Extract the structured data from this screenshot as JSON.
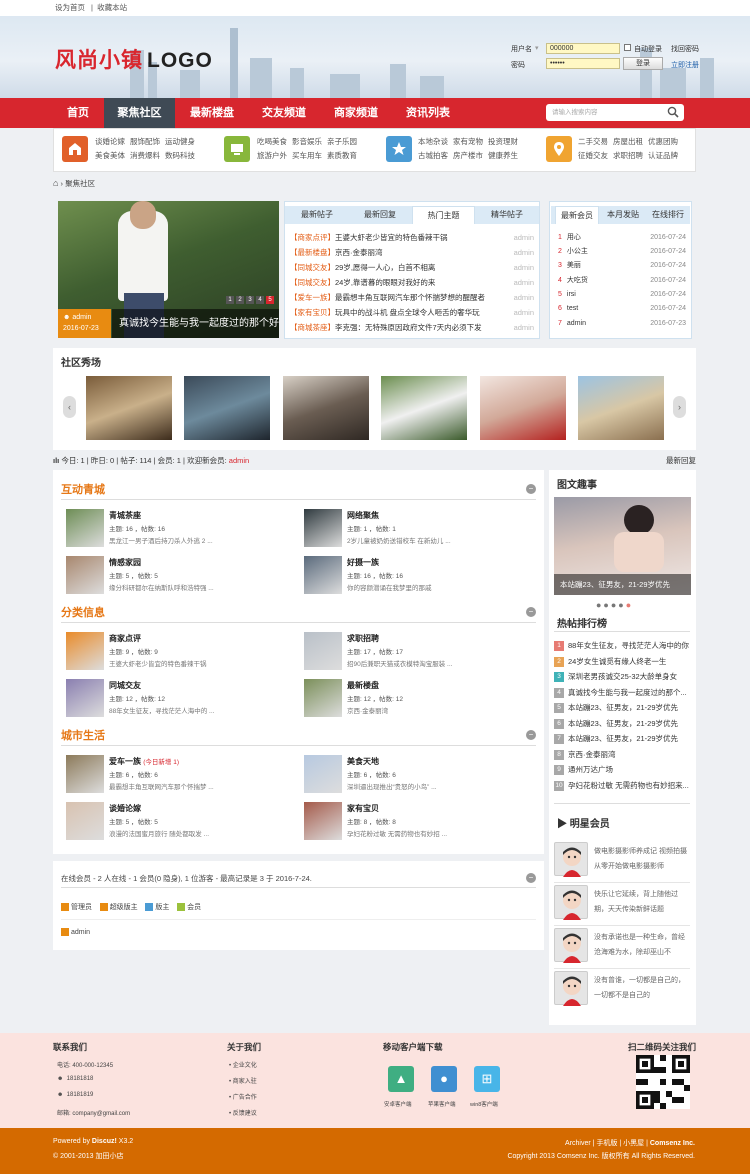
{
  "topbar": {
    "set_home": "设为首页",
    "bookmark": "收藏本站"
  },
  "header": {
    "logo_cn": "风尚小镇",
    "logo_en": "LOGO",
    "login": {
      "username_label": "用户名",
      "username_value": "000000",
      "auto_login_label": "自动登录",
      "find_password": "找回密码",
      "password_label": "密码",
      "password_value": "••••••",
      "login_button": "登录",
      "register": "立即注册"
    }
  },
  "nav": {
    "items": [
      {
        "label": "首页"
      },
      {
        "label": "聚焦社区"
      },
      {
        "label": "最新楼盘"
      },
      {
        "label": "交友频道"
      },
      {
        "label": "商家频道"
      },
      {
        "label": "资讯列表"
      }
    ],
    "active_index": 1,
    "search_placeholder": "请输入搜索内容"
  },
  "categories": [
    {
      "icon": "home-icon",
      "color": "#e1602a",
      "row1": [
        "谈婚论嫁",
        "服饰配饰",
        "运动健身"
      ],
      "row2": [
        "美食美体",
        "消费爆料",
        "数码科技"
      ]
    },
    {
      "icon": "monitor-icon",
      "color": "#88b73b",
      "row1": [
        "吃喝美食",
        "影音娱乐",
        "亲子乐园"
      ],
      "row2": [
        "旅游户外",
        "买车用车",
        "素质教育"
      ]
    },
    {
      "icon": "star-icon",
      "color": "#4a9bd4",
      "row1": [
        "本地杂谈",
        "家有宠物",
        "投资理财"
      ],
      "row2": [
        "古城拍客",
        "房产楼市",
        "健康养生"
      ]
    },
    {
      "icon": "location-icon",
      "color": "#f0a431",
      "row1": [
        "二手交易",
        "房屋出租",
        "优惠团购"
      ],
      "row2": [
        "征婚交友",
        "求职招聘",
        "认证品牌"
      ]
    }
  ],
  "breadcrumb": {
    "current": "聚焦社区"
  },
  "slider": {
    "author": "admin",
    "date": "2016-07-23",
    "title": "真诚找今生能与我一起度过的那个好",
    "pages": [
      "1",
      "2",
      "3",
      "4",
      "5"
    ],
    "active_page": 5
  },
  "posts": {
    "tabs": [
      "最新帖子",
      "最新回复",
      "热门主题",
      "精华帖子"
    ],
    "active_tab": 2,
    "rows": [
      {
        "cat": "【商家点评】",
        "title": "王婆大虾老少皆宜的特色番辣干锅",
        "author": "admin"
      },
      {
        "cat": "【最新楼盘】",
        "title": "京西·金泰丽湾",
        "author": "admin"
      },
      {
        "cat": "【同城交友】",
        "title": "29岁,愿得一人心，白首不相离",
        "author": "admin"
      },
      {
        "cat": "【同城交友】",
        "title": "24岁,靠谱暮的眼眼对我好的来",
        "author": "admin"
      },
      {
        "cat": "【爱车一族】",
        "title": "最霸想丰角互联网汽车那个怀揣梦想的醒醒者",
        "author": "admin"
      },
      {
        "cat": "【家有宝贝】",
        "title": "玩具中的战斗机 盘点全球令人咂舌的奢华玩",
        "author": "admin"
      },
      {
        "cat": "【商城茶座】",
        "title": "李克强：无特殊原因政府文件7天内必须下发",
        "author": "admin"
      }
    ]
  },
  "members": {
    "tabs": [
      "最新会员",
      "本月发贴",
      "在线排行"
    ],
    "active_tab": 0,
    "rows": [
      {
        "n": "1",
        "name": "用心",
        "date": "2016-07-24"
      },
      {
        "n": "2",
        "name": "小公主",
        "date": "2016-07-24"
      },
      {
        "n": "3",
        "name": "美丽",
        "date": "2016-07-24"
      },
      {
        "n": "4",
        "name": "大吃货",
        "date": "2016-07-24"
      },
      {
        "n": "5",
        "name": "irsi",
        "date": "2016-07-24"
      },
      {
        "n": "6",
        "name": "test",
        "date": "2016-07-24"
      },
      {
        "n": "7",
        "name": "admin",
        "date": "2016-07-23"
      }
    ]
  },
  "show": {
    "title": "社区秀场",
    "images": [
      {
        "name": "show-image-1",
        "bg": "linear-gradient(160deg,#7a5c3a,#c9b08a 50%,#3d2c1c)"
      },
      {
        "name": "show-image-2",
        "bg": "linear-gradient(160deg,#3b4a59,#6d8a9c 50%,#1e252d)"
      },
      {
        "name": "show-image-3",
        "bg": "linear-gradient(160deg,#d8d0c6,#6a5d52 50%,#2f2823)"
      },
      {
        "name": "show-image-4",
        "bg": "linear-gradient(160deg,#6b8e4f,#f0f0f0 50%,#3a5a2a)"
      },
      {
        "name": "show-image-5",
        "bg": "linear-gradient(160deg,#f2e6e0,#d2a999 50%,#b4211f)"
      },
      {
        "name": "show-image-6",
        "bg": "linear-gradient(160deg,#9cc3e2,#d8c7a5 50%,#8a6f4f)"
      }
    ]
  },
  "stats": {
    "today_label": "今日:",
    "today": "1",
    "yesterday_label": "昨日:",
    "yesterday": "0",
    "posts_label": "帖子:",
    "posts": "114",
    "members_label": "会员:",
    "members": "1",
    "welcome_label": "欢迎新会员:",
    "new_member": "admin",
    "latest_reply": "最新回复"
  },
  "forum": {
    "sections": [
      {
        "title": "互动青城",
        "boards": [
          {
            "name": "青城茶座",
            "new": "",
            "topics": "16",
            "posts": "16",
            "desc": "黑龙江一男子酒后持刀杀人外逃 2 ..."
          },
          {
            "name": "网络聚焦",
            "new": "",
            "topics": "1",
            "posts": "1",
            "desc": "2岁儿童被奶奶送错校车 在新幼儿 ..."
          },
          {
            "name": "情感家园",
            "new": "",
            "topics": "5",
            "posts": "5",
            "desc": "缘分科研都尔在纳斯队呼和浩特强 ..."
          },
          {
            "name": "好摄一族",
            "new": "",
            "topics": "16",
            "posts": "16",
            "desc": "你的容颜潜诵在我梦里的那戚"
          }
        ]
      },
      {
        "title": "分类信息",
        "boards": [
          {
            "name": "商家点评",
            "new": "",
            "topics": "9",
            "posts": "9",
            "desc": "王婆大虾老少皆宜的特色番辣干锅"
          },
          {
            "name": "求职招聘",
            "new": "",
            "topics": "17",
            "posts": "17",
            "desc": "招90后兼职天猫或衣模特淘宝服装 ..."
          },
          {
            "name": "同城交友",
            "new": "",
            "topics": "12",
            "posts": "12",
            "desc": "88年女生征友，寻找茫茫人海中的 ..."
          },
          {
            "name": "最新楼盘",
            "new": "",
            "topics": "12",
            "posts": "12",
            "desc": "京西·金泰丽湾"
          }
        ]
      },
      {
        "title": "城市生活",
        "boards": [
          {
            "name": "爱车一族",
            "new": "(今日新增 1)",
            "topics": "6",
            "posts": "6",
            "desc": "最霸想丰角互联网汽车那个怀揣梦 ..."
          },
          {
            "name": "美食天地",
            "new": "",
            "topics": "6",
            "posts": "6",
            "desc": "深圳逼出现推出“贵怒的小鸟” ..."
          },
          {
            "name": "谈婚论嫁",
            "new": "",
            "topics": "5",
            "posts": "5",
            "desc": "浪漫的法国蜜月旅行 随处都取发 ..."
          },
          {
            "name": "家有宝贝",
            "new": "",
            "topics": "8",
            "posts": "8",
            "desc": "孕妇花粉过敏 无需药物也有妙招 ..."
          }
        ]
      }
    ],
    "topics_label": "主题:",
    "posts_label": "帖数:"
  },
  "online": {
    "summary": "在线会员 - 2 人在线 - 1 会员(0 隐身), 1 位游客 - 最高记录是 3 于 2016-7-24.",
    "roles": [
      {
        "label": "管理员",
        "color": "#e88b11"
      },
      {
        "label": "超级版主",
        "color": "#e88b11"
      },
      {
        "label": "版主",
        "color": "#4a9bd4"
      },
      {
        "label": "会员",
        "color": "#9bc13c"
      }
    ],
    "user": "admin"
  },
  "right": {
    "pic_title": "图文趣事",
    "pic_caption": "本站蹦23、征男友，21-29岁优先",
    "rank_title": "热帖排行榜",
    "ranks": [
      {
        "n": "1",
        "t": "88年女生征友，寻找茫茫人海中的你",
        "c": "#e77b73"
      },
      {
        "n": "2",
        "t": "24岁女生诚觅有缘人终老一生",
        "c": "#e8a355"
      },
      {
        "n": "3",
        "t": "深圳老男孩诚交25-32大龄单身女",
        "c": "#3fb2b7"
      },
      {
        "n": "4",
        "t": "真诚找今生能与我一起度过的那个...",
        "c": "#a8a8a8"
      },
      {
        "n": "5",
        "t": "本站蹦23、征男友，21-29岁优先",
        "c": "#a8a8a8"
      },
      {
        "n": "6",
        "t": "本站蹦23、征男友，21-29岁优先",
        "c": "#a8a8a8"
      },
      {
        "n": "7",
        "t": "本站蹦23、征男友，21-29岁优先",
        "c": "#a8a8a8"
      },
      {
        "n": "8",
        "t": "京西·金泰丽湾",
        "c": "#a8a8a8"
      },
      {
        "n": "9",
        "t": "通州万达广场",
        "c": "#a8a8a8"
      },
      {
        "n": "10",
        "t": "孕妇花粉过敏 无需药物也有妙招来...",
        "c": "#a8a8a8"
      }
    ],
    "star_title": "明星会员",
    "stars": [
      {
        "text": "做电影摄影师养成记 视频拍摄从零开始做电影摄影师"
      },
      {
        "text": "快乐让它延续，背上随他过期，天天传染新鲜话题"
      },
      {
        "text": "没有承诺也是一种生命，曾经沧海难为水，除却巫山不"
      },
      {
        "text": "没有曾谁，一切都是自己的，一切都不是自己的"
      }
    ]
  },
  "footer": {
    "contact_title": "联系我们",
    "phone": "电话: 400-000-12345",
    "qq1": "18181818",
    "qq2": "18181819",
    "email": "邮箱: company@gmail.com",
    "about_title": "关于我们",
    "about_items": [
      "企业文化",
      "商家入驻",
      "广告合作",
      "反馈建议"
    ],
    "app_title": "移动客户端下载",
    "apps": [
      {
        "label": "安卓客户端",
        "color": "#3fae82",
        "glyph": "▲"
      },
      {
        "label": "苹果客户端",
        "color": "#3f8fd1",
        "glyph": "●"
      },
      {
        "label": "win8客户端",
        "color": "#48b5e8",
        "glyph": "⊞"
      }
    ],
    "qr_title": "扫二维码关注我们",
    "powered_by": "Powered by",
    "discuz": "Discuz!",
    "version": "X3.2",
    "copyright_left": "© 2001-2013 加田小店",
    "links": [
      "Archiver",
      "手机版",
      "小黑屋",
      "Comsenz Inc."
    ],
    "copyright_right": "Copyright 2013 Comsenz Inc. 版权所有 All Rights Reserved."
  }
}
